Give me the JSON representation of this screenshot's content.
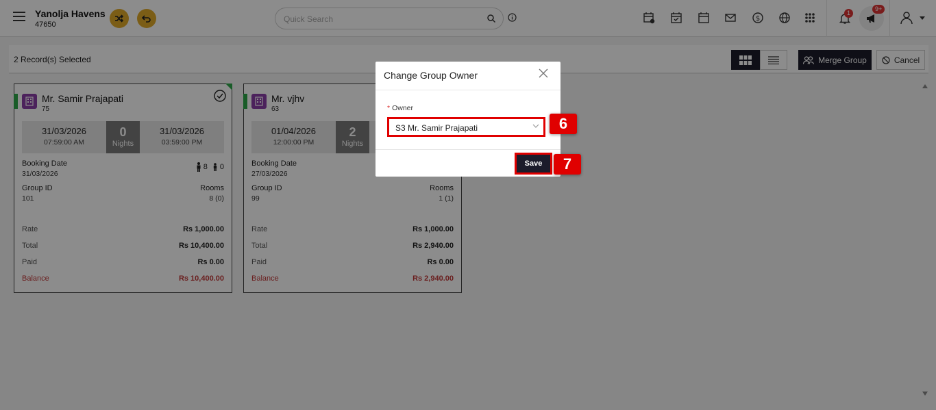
{
  "header": {
    "hotel_name": "Yanolja Havens",
    "hotel_id": "47650",
    "search_placeholder": "Quick Search",
    "notifications_count": "1",
    "announcements_count": "9+"
  },
  "toolbar": {
    "selected_text": "2 Record(s) Selected",
    "merge_label": "Merge Group",
    "cancel_label": "Cancel"
  },
  "cards": [
    {
      "guest": "Mr. Samir Prajapati",
      "id": "75",
      "arrival_date": "31/03/2026",
      "arrival_time": "07:59:00 AM",
      "nights": "0",
      "nights_label": "Nights",
      "departure_date": "31/03/2026",
      "departure_time": "03:59:00 PM",
      "booking_date_label": "Booking Date",
      "booking_date": "31/03/2026",
      "adults": "8",
      "children": "0",
      "group_id_label": "Group ID",
      "group_id": "101",
      "rooms_label": "Rooms",
      "rooms": "8 (0)",
      "rate_label": "Rate",
      "rate": "Rs 1,000.00",
      "total_label": "Total",
      "total": "Rs 10,400.00",
      "paid_label": "Paid",
      "paid": "Rs 0.00",
      "balance_label": "Balance",
      "balance": "Rs 10,400.00"
    },
    {
      "guest": "Mr. vjhv",
      "id": "63",
      "arrival_date": "01/04/2026",
      "arrival_time": "12:00:00 PM",
      "nights": "2",
      "nights_label": "Nights",
      "booking_date_label": "Booking Date",
      "booking_date": "27/03/2026",
      "group_id_label": "Group ID",
      "group_id": "99",
      "rooms_label": "Rooms",
      "rooms": "1 (1)",
      "rate_label": "Rate",
      "rate": "Rs 1,000.00",
      "total_label": "Total",
      "total": "Rs 2,940.00",
      "paid_label": "Paid",
      "paid": "Rs 0.00",
      "balance_label": "Balance",
      "balance": "Rs 2,940.00"
    }
  ],
  "modal": {
    "title": "Change Group Owner",
    "required_mark": "*",
    "owner_label": "Owner",
    "owner_value": "S3 Mr. Samir Prajapati",
    "save_label": "Save"
  },
  "callouts": {
    "owner_step": "6",
    "save_step": "7"
  },
  "colors": {
    "accent_gold": "#e0a928",
    "dark_button": "#1c1c2b",
    "highlight_red": "#e00000",
    "status_green": "#2ea84a",
    "balance_red": "#c23a3a"
  }
}
